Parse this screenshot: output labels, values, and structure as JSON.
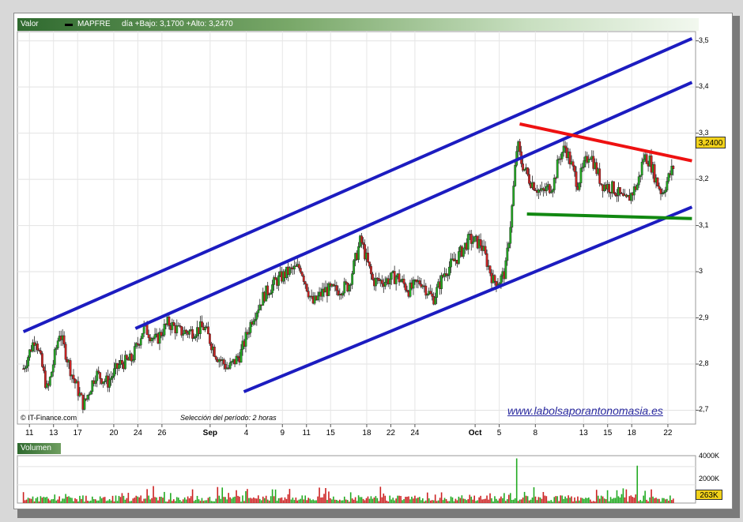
{
  "header": {
    "field1": "Valor",
    "ticker": "MAPFRE",
    "info": "día +Bajo: 3,1700 +Alto: 3,2470"
  },
  "footer": {
    "copyright": "© IT-Finance.com",
    "period": "Selección del período: 2 horas",
    "website": "www.labolsaporantonomasia.es"
  },
  "volume_panel": {
    "title": "Volumen",
    "tick_labels": [
      "4000K",
      "2000K"
    ],
    "last_value": "263K"
  },
  "colors": {
    "channel": "#1c1cc0",
    "resistance": "#ee1111",
    "support": "#118811",
    "up_candle": "#22aa22",
    "down_candle": "#cc2222",
    "price_box": "#f2d21a"
  },
  "chart_data": {
    "type": "candlestick",
    "ticker": "MAPFRE",
    "last_price_label": "3,2400",
    "y_ticks": [
      2.7,
      2.8,
      2.9,
      3.0,
      3.1,
      3.2,
      3.3,
      3.4,
      3.5
    ],
    "y_tick_labels": [
      "2,7",
      "2,8",
      "2,9",
      "3",
      "3,1",
      "3,2",
      "3,3",
      "3,4",
      "3,5"
    ],
    "ylim": [
      2.67,
      3.52
    ],
    "x_ticks": [
      {
        "label": "11",
        "t": 0.5
      },
      {
        "label": "13",
        "t": 2.5
      },
      {
        "label": "17",
        "t": 4.5
      },
      {
        "label": "20",
        "t": 7.5
      },
      {
        "label": "24",
        "t": 9.5
      },
      {
        "label": "26",
        "t": 11.5
      },
      {
        "label": "Sep",
        "t": 15.5,
        "month": true
      },
      {
        "label": "4",
        "t": 18.5
      },
      {
        "label": "9",
        "t": 21.5
      },
      {
        "label": "11",
        "t": 23.5
      },
      {
        "label": "15",
        "t": 25.5
      },
      {
        "label": "18",
        "t": 28.5
      },
      {
        "label": "22",
        "t": 30.5
      },
      {
        "label": "24",
        "t": 32.5
      },
      {
        "label": "Oct",
        "t": 37.5,
        "month": true
      },
      {
        "label": "5",
        "t": 39.5
      },
      {
        "label": "8",
        "t": 42.5
      },
      {
        "label": "13",
        "t": 46.5
      },
      {
        "label": "15",
        "t": 48.5
      },
      {
        "label": "18",
        "t": 50.5
      },
      {
        "label": "22",
        "t": 53.5
      }
    ],
    "path": [
      [
        0,
        2.79
      ],
      [
        1,
        2.86
      ],
      [
        2,
        2.74
      ],
      [
        3,
        2.87
      ],
      [
        4,
        2.78
      ],
      [
        5,
        2.71
      ],
      [
        6,
        2.78
      ],
      [
        7,
        2.76
      ],
      [
        8,
        2.8
      ],
      [
        9,
        2.81
      ],
      [
        10,
        2.88
      ],
      [
        11,
        2.85
      ],
      [
        12,
        2.89
      ],
      [
        13,
        2.87
      ],
      [
        14,
        2.87
      ],
      [
        15,
        2.88
      ],
      [
        16,
        2.82
      ],
      [
        17,
        2.79
      ],
      [
        18,
        2.82
      ],
      [
        19,
        2.9
      ],
      [
        20,
        2.95
      ],
      [
        21,
        2.98
      ],
      [
        22,
        3.0
      ],
      [
        23,
        3.01
      ],
      [
        24,
        2.93
      ],
      [
        25,
        2.96
      ],
      [
        26,
        2.96
      ],
      [
        27,
        2.97
      ],
      [
        28,
        3.07
      ],
      [
        29,
        2.98
      ],
      [
        30,
        2.98
      ],
      [
        31,
        2.99
      ],
      [
        32,
        2.96
      ],
      [
        33,
        2.98
      ],
      [
        34,
        2.94
      ],
      [
        35,
        3.0
      ],
      [
        36,
        3.03
      ],
      [
        37,
        3.07
      ],
      [
        38,
        3.06
      ],
      [
        39,
        2.98
      ],
      [
        39.5,
        2.98
      ],
      [
        40,
        3.0
      ],
      [
        40.5,
        3.12
      ],
      [
        41,
        3.28
      ],
      [
        41.3,
        3.24
      ],
      [
        42,
        3.2
      ],
      [
        43,
        3.17
      ],
      [
        44,
        3.19
      ],
      [
        44.5,
        3.25
      ],
      [
        45,
        3.27
      ],
      [
        46,
        3.19
      ],
      [
        47,
        3.26
      ],
      [
        48,
        3.19
      ],
      [
        49,
        3.18
      ],
      [
        50,
        3.15
      ],
      [
        51,
        3.19
      ],
      [
        51.5,
        3.25
      ],
      [
        52,
        3.24
      ],
      [
        52.5,
        3.2
      ],
      [
        53,
        3.17
      ],
      [
        53.5,
        3.2
      ],
      [
        54,
        3.23
      ]
    ],
    "trendlines": [
      {
        "name": "channel-upper",
        "color": "blue",
        "from": [
          0,
          2.87
        ],
        "to": [
          55.5,
          3.505
        ]
      },
      {
        "name": "channel-middle",
        "color": "blue",
        "from": [
          9.3,
          2.877
        ],
        "to": [
          55.5,
          3.41
        ]
      },
      {
        "name": "channel-lower",
        "color": "blue",
        "from": [
          18.3,
          2.74
        ],
        "to": [
          55.5,
          3.14
        ]
      },
      {
        "name": "resistance",
        "color": "red",
        "from": [
          41.2,
          3.32
        ],
        "to": [
          55.5,
          3.24
        ]
      },
      {
        "name": "support",
        "color": "green",
        "from": [
          41.8,
          3.125
        ],
        "to": [
          55.5,
          3.115
        ]
      }
    ],
    "volume": {
      "unit": "K",
      "spikes": [
        {
          "t": 41,
          "value": 4900
        },
        {
          "t": 51,
          "value": 4100
        }
      ],
      "typical_max": 1900,
      "last": 263
    }
  }
}
